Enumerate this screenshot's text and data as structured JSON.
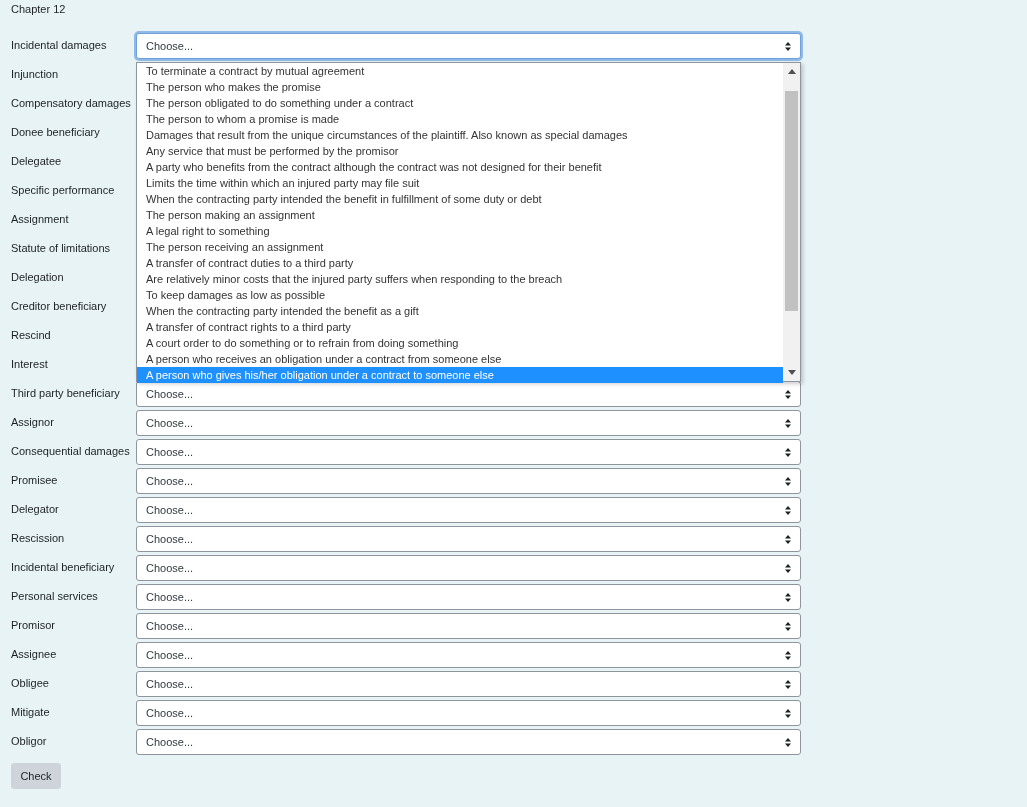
{
  "heading": "Chapter 12",
  "rows": [
    {
      "label": "Incidental damages",
      "value": "Choose...",
      "open": true,
      "options": [
        {
          "text": "To terminate a contract by mutual agreement",
          "selected": false
        },
        {
          "text": "The person who makes the promise",
          "selected": false
        },
        {
          "text": "The person obligated to do something under a contract",
          "selected": false
        },
        {
          "text": "The person to whom a promise is made",
          "selected": false
        },
        {
          "text": "Damages that result from the unique circumstances of the plaintiff. Also known as special damages",
          "selected": false
        },
        {
          "text": "Any service that must be performed by the promisor",
          "selected": false
        },
        {
          "text": "A party who benefits from the contract although the contract was not designed for their benefit",
          "selected": false
        },
        {
          "text": "Limits the time within which an injured party may file suit",
          "selected": false
        },
        {
          "text": "When the contracting party intended the benefit in fulfillment of some duty or debt",
          "selected": false
        },
        {
          "text": "The person making an assignment",
          "selected": false
        },
        {
          "text": "A legal right to something",
          "selected": false
        },
        {
          "text": "The person receiving an assignment",
          "selected": false
        },
        {
          "text": "A transfer of contract duties to a third party",
          "selected": false
        },
        {
          "text": "Are relatively minor costs that the injured party suffers when responding to the breach",
          "selected": false
        },
        {
          "text": "To keep damages as low as possible",
          "selected": false
        },
        {
          "text": "When the contracting party intended the benefit as a gift",
          "selected": false
        },
        {
          "text": "A transfer of contract rights to a third party",
          "selected": false
        },
        {
          "text": "A court order to do something or to refrain from doing something",
          "selected": false
        },
        {
          "text": "A person who receives an obligation under a contract from someone else",
          "selected": false
        },
        {
          "text": "A person who gives his/her obligation under a contract to someone else",
          "selected": true
        }
      ]
    },
    {
      "label": "Injunction"
    },
    {
      "label": "Compensatory damages"
    },
    {
      "label": "Donee beneficiary"
    },
    {
      "label": "Delegatee"
    },
    {
      "label": "Specific performance"
    },
    {
      "label": "Assignment"
    },
    {
      "label": "Statute of limitations"
    },
    {
      "label": "Delegation"
    },
    {
      "label": "Creditor beneficiary"
    },
    {
      "label": "Rescind"
    },
    {
      "label": "Interest"
    },
    {
      "label": "Third party beneficiary",
      "value": "Choose..."
    },
    {
      "label": "Assignor",
      "value": "Choose..."
    },
    {
      "label": "Consequential damages",
      "value": "Choose..."
    },
    {
      "label": "Promisee",
      "value": "Choose..."
    },
    {
      "label": "Delegator",
      "value": "Choose..."
    },
    {
      "label": "Rescission",
      "value": "Choose..."
    },
    {
      "label": "Incidental beneficiary",
      "value": "Choose..."
    },
    {
      "label": "Personal services",
      "value": "Choose..."
    },
    {
      "label": "Promisor",
      "value": "Choose..."
    },
    {
      "label": "Assignee",
      "value": "Choose..."
    },
    {
      "label": "Obligee",
      "value": "Choose..."
    },
    {
      "label": "Mitigate",
      "value": "Choose..."
    },
    {
      "label": "Obligor",
      "value": "Choose..."
    }
  ],
  "check_button": "Check"
}
